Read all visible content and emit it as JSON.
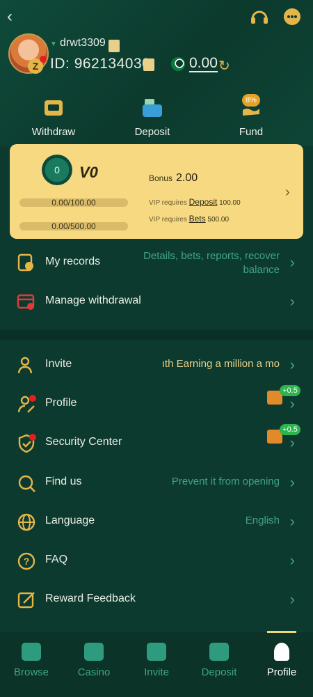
{
  "header": {
    "username": "drwt3309",
    "id_label": "ID:",
    "id_value": "962134030",
    "balance": "0.00",
    "avatar_level_badge": "Z"
  },
  "actions": [
    {
      "label": "Withdraw",
      "icon": "withdraw-icon"
    },
    {
      "label": "Deposit",
      "icon": "deposit-wallet-icon"
    },
    {
      "label": "Fund",
      "icon": "fund-hand-icon",
      "badge": "8%"
    }
  ],
  "vip": {
    "coin_text": "0",
    "level": "V0",
    "progress1": "0.00/100.00",
    "progress2": "0.00/500.00",
    "bonus_label": "Bonus",
    "bonus_value": "2.00",
    "req1_text": "VIP requires",
    "req1_link": "Deposit",
    "req1_value": "100.00",
    "req2_text": "VIP requires",
    "req2_link": "Bets",
    "req2_value": "500.00"
  },
  "records": [
    {
      "label": "My records",
      "hint_line1": "Details, bets, reports, recover",
      "hint_line2": "balance"
    },
    {
      "label": "Manage withdrawal",
      "hint_line1": "",
      "hint_line2": ""
    }
  ],
  "menu": [
    {
      "label": "Invite",
      "hint": "ıth  Earning a million a mo"
    },
    {
      "label": "Profile",
      "hint": "",
      "gift_badge": "+0.5"
    },
    {
      "label": "Security Center",
      "hint": "",
      "gift_badge": "+0.5"
    },
    {
      "label": "Find us",
      "hint": "Prevent it from opening"
    },
    {
      "label": "Language",
      "hint": "English"
    },
    {
      "label": "FAQ",
      "hint": ""
    },
    {
      "label": "Reward Feedback",
      "hint": ""
    }
  ],
  "nav": [
    {
      "label": "Browse"
    },
    {
      "label": "Casino"
    },
    {
      "label": "Invite"
    },
    {
      "label": "Deposit"
    },
    {
      "label": "Profile"
    }
  ],
  "colors": {
    "accent": "#f6d980",
    "teal": "#3fa484",
    "bg": "#0d3a2e"
  }
}
